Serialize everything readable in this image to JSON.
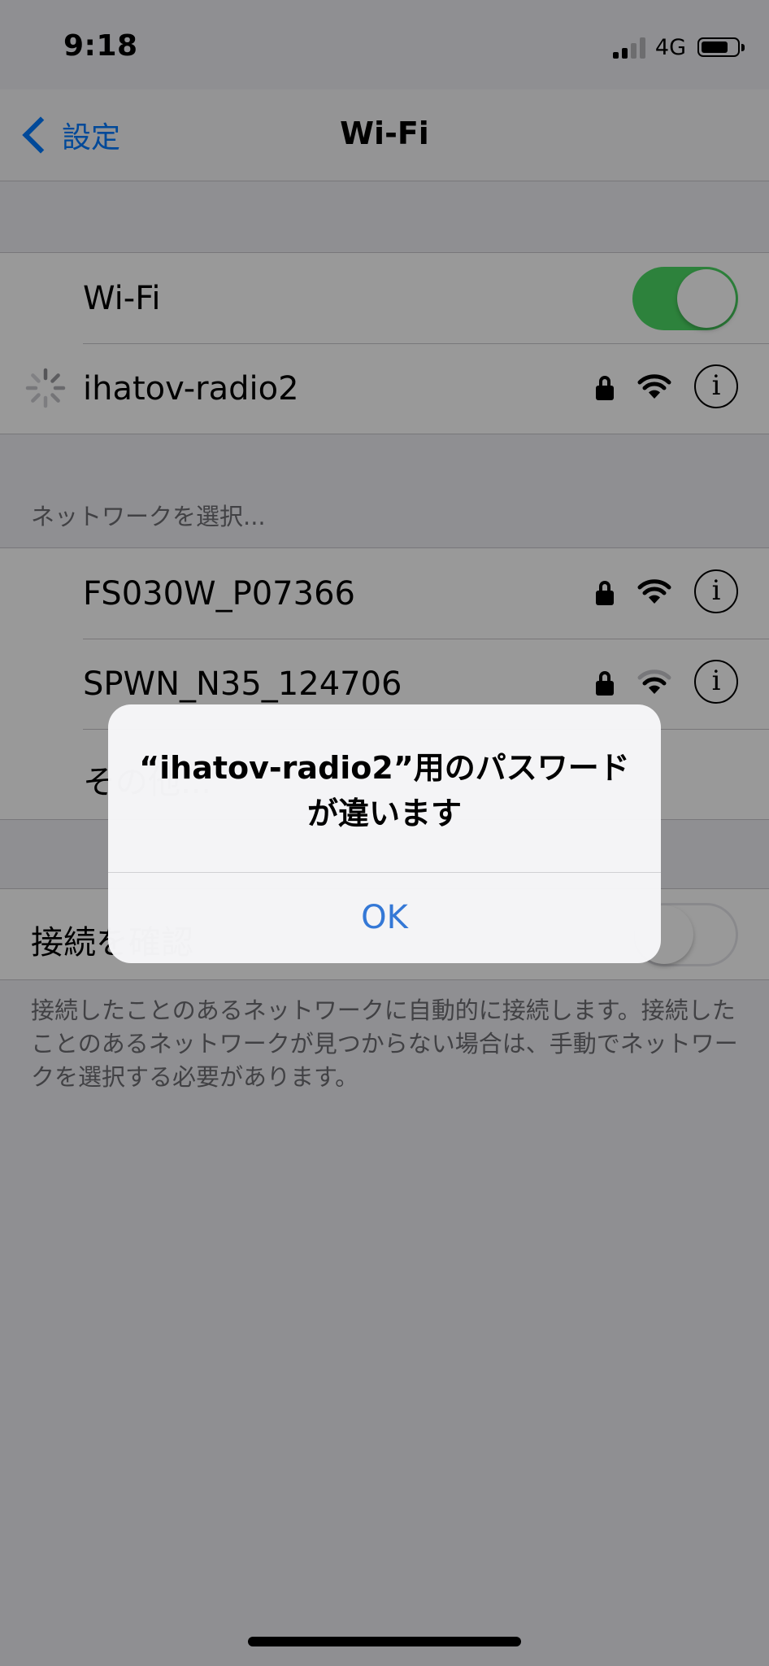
{
  "status_bar": {
    "time": "9:18",
    "network": "4G"
  },
  "nav": {
    "back_label": "設定",
    "title": "Wi-Fi"
  },
  "wifi": {
    "label": "Wi-Fi",
    "enabled": true
  },
  "current_network": {
    "name": "ihatov-radio2",
    "connecting": true
  },
  "networks_section": {
    "header": "ネットワークを選択...",
    "items": [
      {
        "name": "FS030W_P07366"
      },
      {
        "name": "SPWN_N35_124706"
      },
      {
        "name": "その他..."
      }
    ]
  },
  "ask_to_join": {
    "label": "接続を確認",
    "enabled": false,
    "footer": "接続したことのあるネットワークに自動的に接続します。接続したことのあるネットワークが見つからない場合は、手動でネットワークを選択する必要があります。"
  },
  "alert": {
    "title": "“ihatov-radio2”用のパスワードが違います",
    "button_label": "OK",
    "button_color": "#3478d6"
  },
  "colors": {
    "toggle_on": "#4cd964",
    "tint": "#007aff"
  }
}
